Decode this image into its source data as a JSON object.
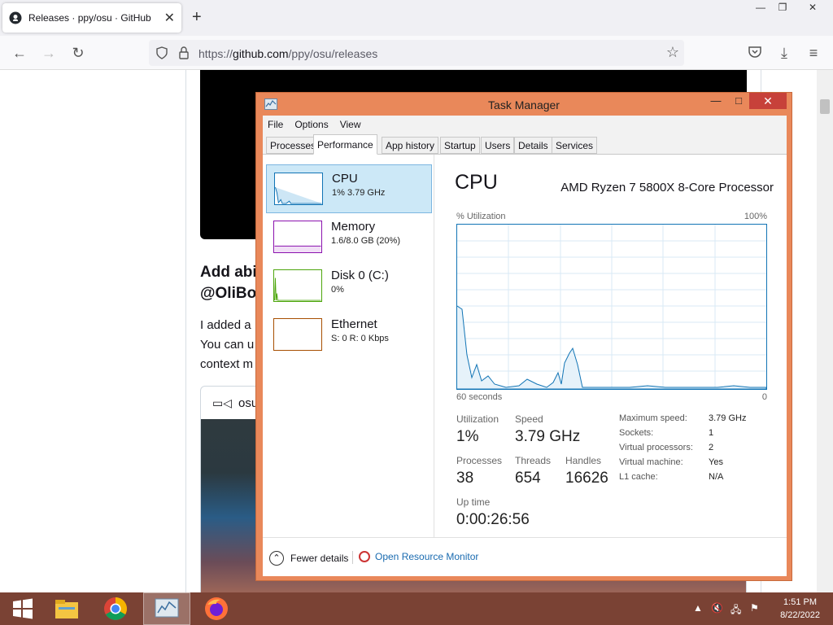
{
  "browser": {
    "tab_title": "Releases · ppy/osu · GitHub",
    "url_prefix": "https://",
    "url_host": "github.com",
    "url_path": "/ppy/osu/releases"
  },
  "page": {
    "heading": "Add abi\n@OliBo",
    "paragraph": "I added a\nYou can u\ncontext m",
    "video_label": "osu."
  },
  "task_manager": {
    "title": "Task Manager",
    "menu": [
      "File",
      "Options",
      "View"
    ],
    "tabs": [
      "Processes",
      "Performance",
      "App history",
      "Startup",
      "Users",
      "Details",
      "Services"
    ],
    "active_tab": "Performance",
    "side": [
      {
        "name": "CPU",
        "value": "1%  3.79 GHz",
        "color": "#1174b5"
      },
      {
        "name": "Memory",
        "value": "1.6/8.0 GB (20%)",
        "color": "#8b12ae"
      },
      {
        "name": "Disk 0 (C:)",
        "value": "0%",
        "color": "#4da60c"
      },
      {
        "name": "Ethernet",
        "value": "S: 0  R: 0 Kbps",
        "color": "#a74f01"
      }
    ],
    "detail": {
      "title": "CPU",
      "cpu_name": "AMD Ryzen 7 5800X 8-Core Processor",
      "util_label": "% Utilization",
      "max_label": "100%",
      "time_label": "60 seconds",
      "min_label": "0",
      "utilization_label": "Utilization",
      "utilization": "1%",
      "speed_label": "Speed",
      "speed": "3.79 GHz",
      "processes_label": "Processes",
      "processes": "38",
      "threads_label": "Threads",
      "threads": "654",
      "handles_label": "Handles",
      "handles": "16626",
      "uptime_label": "Up time",
      "uptime": "0:00:26:56",
      "info": [
        {
          "label": "Maximum speed:",
          "value": "3.79 GHz"
        },
        {
          "label": "Sockets:",
          "value": "1"
        },
        {
          "label": "Virtual processors:",
          "value": "2"
        },
        {
          "label": "Virtual machine:",
          "value": "Yes"
        },
        {
          "label": "L1 cache:",
          "value": "N/A"
        }
      ]
    },
    "fewer_details": "Fewer details",
    "resource_monitor": "Open Resource Monitor"
  },
  "taskbar": {
    "time": "1:51 PM",
    "date": "8/22/2022"
  }
}
